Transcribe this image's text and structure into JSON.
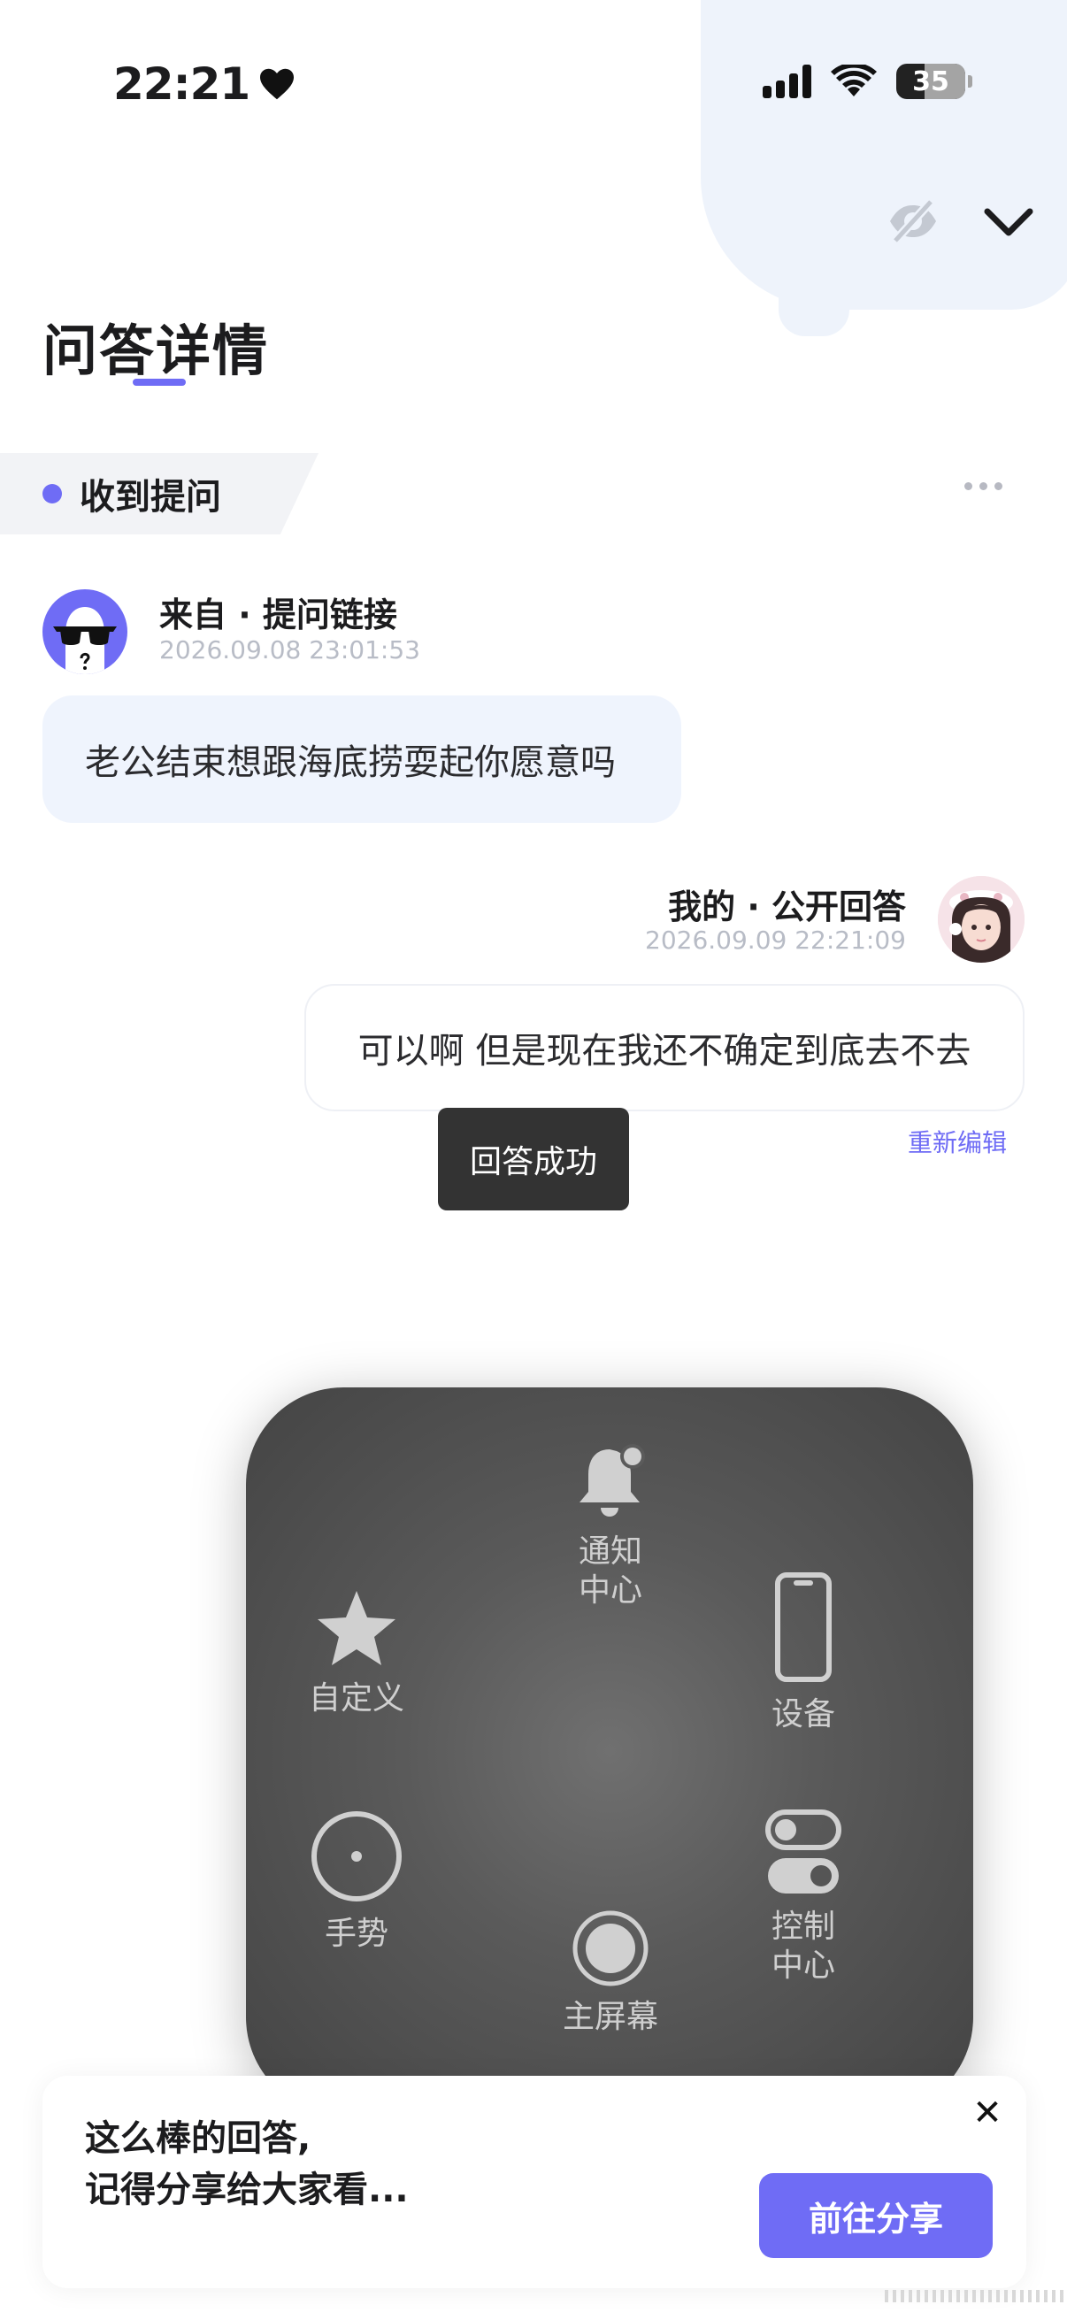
{
  "status_bar": {
    "time": "22:21",
    "battery": "35"
  },
  "header": {
    "title": "问答详情",
    "accent_color": "#6f6cf5"
  },
  "section": {
    "label": "收到提问"
  },
  "question": {
    "from": "来自 · 提问链接",
    "time": "2026.09.08 23:01:53",
    "text": "老公结束想跟海底捞耍起你愿意吗"
  },
  "answer": {
    "from": "我的 · 公开回答",
    "time": "2026.09.09 22:21:09",
    "text": "可以啊 但是现在我还不确定到底去不去",
    "edit_label": "重新编辑"
  },
  "toast": {
    "text": "回答成功"
  },
  "assistive_touch": {
    "items": [
      {
        "label": "通知\n中心",
        "icon": "bell-icon"
      },
      {
        "label": "自定义",
        "icon": "star-icon"
      },
      {
        "label": "设备",
        "icon": "phone-icon"
      },
      {
        "label": "手势",
        "icon": "gesture-icon"
      },
      {
        "label": "控制\n中心",
        "icon": "toggles-icon"
      },
      {
        "label": "主屏幕",
        "icon": "home-icon"
      }
    ]
  },
  "share_card": {
    "line1": "这么棒的回答,",
    "line2": "记得分享给大家看...",
    "button_label": "前往分享"
  }
}
